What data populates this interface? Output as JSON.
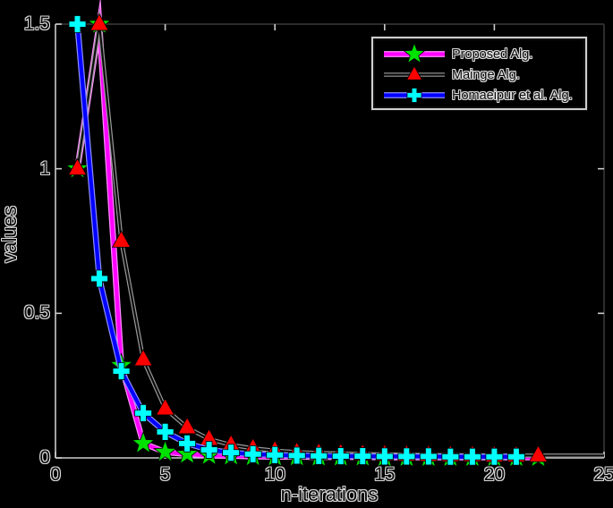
{
  "figure": {
    "background": "#000000",
    "axis_front_color": "#cccccc",
    "axis_back_color": "#2d2d2d",
    "text_fill": "#0b0b0b",
    "text_halo": "#dedede"
  },
  "chart_data": {
    "type": "line",
    "title": "",
    "xlabel": "n-iterations",
    "ylabel": "values",
    "xlim": [
      0,
      25
    ],
    "ylim": [
      0,
      1.5
    ],
    "x_ticks": [
      "0",
      "5",
      "10",
      "15",
      "20",
      "25"
    ],
    "y_ticks": [
      "0",
      "0.5",
      "1",
      "1.5"
    ],
    "grid": false,
    "legend_position": "top-right-inside",
    "series": [
      {
        "name": "Proposed Alg.",
        "line_color": "#ff00ff",
        "line_halo": "#ff8dff",
        "line_width": 4.3,
        "marker": "star",
        "marker_color": "#00e100",
        "x": [
          1,
          2,
          3,
          4,
          5,
          6,
          7,
          8,
          9,
          10,
          11,
          12,
          13,
          14,
          15,
          16,
          17,
          18,
          19,
          20,
          21,
          22
        ],
        "y": [
          1.0,
          1.5,
          0.32,
          0.05,
          0.02,
          0.013,
          0.009,
          0.007,
          0.005,
          0.004,
          0.004,
          0.003,
          0.003,
          0.003,
          0.002,
          0.002,
          0.002,
          0.002,
          0.002,
          0.002,
          0.002,
          0.002
        ]
      },
      {
        "name": "Mainge Alg.",
        "line_color": "#0b0b0b",
        "line_halo": "#9a9a9a",
        "line_width": 2.2,
        "marker": "triangle",
        "marker_color": "#ff0000",
        "x": [
          1,
          2,
          3,
          4,
          5,
          6,
          7,
          8,
          9,
          10,
          11,
          12,
          13,
          14,
          15,
          16,
          17,
          18,
          19,
          20,
          21,
          22
        ],
        "y": [
          1.0,
          1.5,
          0.75,
          0.34,
          0.17,
          0.105,
          0.065,
          0.045,
          0.033,
          0.025,
          0.02,
          0.017,
          0.015,
          0.013,
          0.012,
          0.011,
          0.01,
          0.009,
          0.009,
          0.008,
          0.008,
          0.008
        ],
        "line_extends_to_x": 25
      },
      {
        "name": "Homaeipur et al. Alg.",
        "line_color": "#0000ff",
        "line_halo": "#8f8fff",
        "line_width": 4.3,
        "marker": "plus",
        "marker_color": "#00ffff",
        "x": [
          1,
          2,
          3,
          4,
          5,
          6,
          7,
          8,
          9,
          10,
          11,
          12,
          13,
          14,
          15,
          16,
          17,
          18,
          19,
          20,
          21
        ],
        "y": [
          1.5,
          0.62,
          0.3,
          0.155,
          0.09,
          0.05,
          0.028,
          0.018,
          0.013,
          0.01,
          0.008,
          0.007,
          0.006,
          0.006,
          0.005,
          0.005,
          0.005,
          0.004,
          0.004,
          0.004,
          0.004
        ]
      }
    ]
  }
}
